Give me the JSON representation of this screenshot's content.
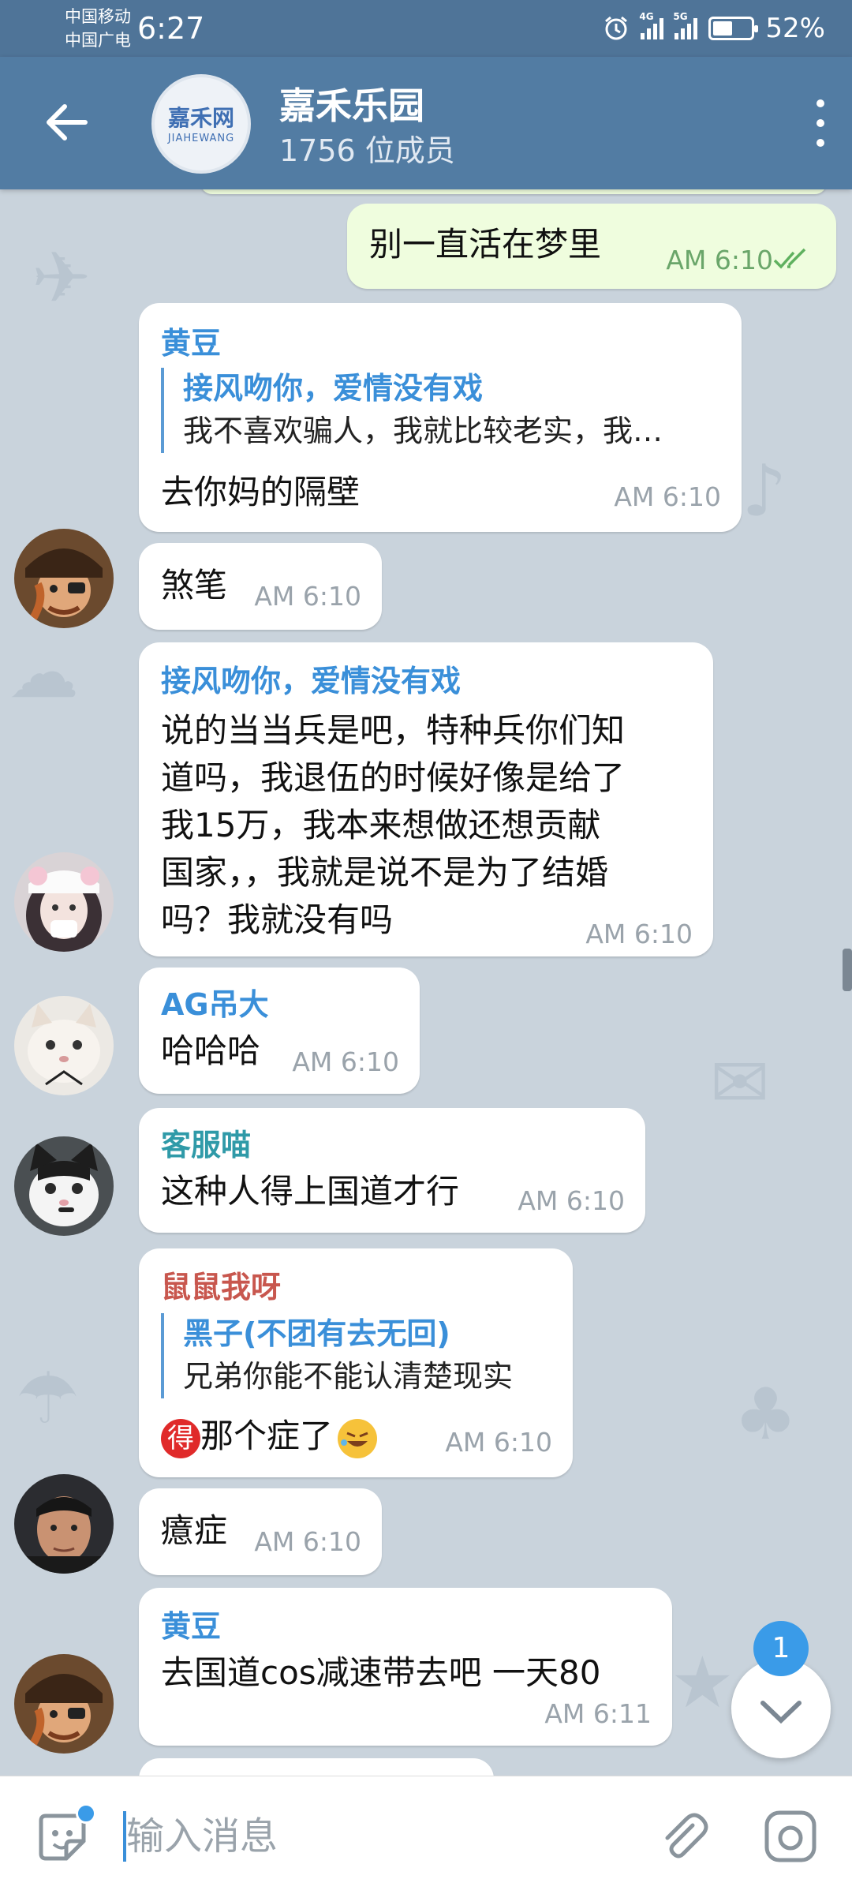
{
  "status_bar": {
    "carrier1": "中国移动",
    "carrier2": "中国广电",
    "time": "6:27",
    "net1": "4G",
    "net2": "5G",
    "battery": "52%",
    "battery_level": 0.52
  },
  "header": {
    "logo_text": "嘉禾网",
    "logo_sub": "JIAHEWANG",
    "title": "嘉禾乐园",
    "subtitle": "1756 位成员"
  },
  "colors": {
    "header": "#527ca3",
    "chat_bg": "#c9d3dc",
    "outgoing": "#effdde",
    "accent": "#3a9be8"
  },
  "messages": [
    {
      "type": "outgoing",
      "text": "别一直活在梦里",
      "time": "AM 6:10",
      "status": "read"
    },
    {
      "sender": "黄豆",
      "sender_color": "#3a8fd9",
      "reply_to": "接风吻你，爱情没有戏",
      "reply_text": "我不喜欢骗人，我就比较老实，我…",
      "text": "去你妈的隔壁",
      "time": "AM 6:10",
      "avatar": "pirate-avatar"
    },
    {
      "text": "煞笔",
      "time": "AM 6:10"
    },
    {
      "sender": "接风吻你，爱情没有戏",
      "sender_color": "#3a8fd9",
      "lines": [
        "说的当当兵是吧，特种兵你们知",
        "道吗，我退伍的时候好像是给了",
        "我15万，我本来想做还想贡献",
        "国家，，我就是说不是为了结婚",
        "吗？我就没有吗"
      ],
      "time": "AM 6:10",
      "avatar": "girl-avatar"
    },
    {
      "sender": "AG吊大",
      "sender_color": "#3a8fd9",
      "text": "哈哈哈",
      "time": "AM 6:10",
      "avatar": "cat-avatar"
    },
    {
      "sender": "客服喵",
      "sender_color": "#2f9aa8",
      "text": "这种人得上国道才行",
      "time": "AM 6:10",
      "avatar": "kitten-avatar"
    },
    {
      "sender": "鼠鼠我呀",
      "sender_color": "#c8574e",
      "reply_to": "黑子(不团有去无回)",
      "reply_text": "兄弟你能不能认清楚现实",
      "emoji_prefix": "得",
      "text": "那个症了",
      "time": "AM 6:10"
    },
    {
      "text": "癔症",
      "time": "AM 6:10",
      "avatar": "man-avatar"
    },
    {
      "sender": "黄豆",
      "sender_color": "#3a8fd9",
      "text": "去国道cos减速带去吧 一天80",
      "time": "AM 6:11",
      "avatar": "pirate-avatar"
    }
  ],
  "unread_count": "1",
  "input": {
    "placeholder": "输入消息"
  }
}
